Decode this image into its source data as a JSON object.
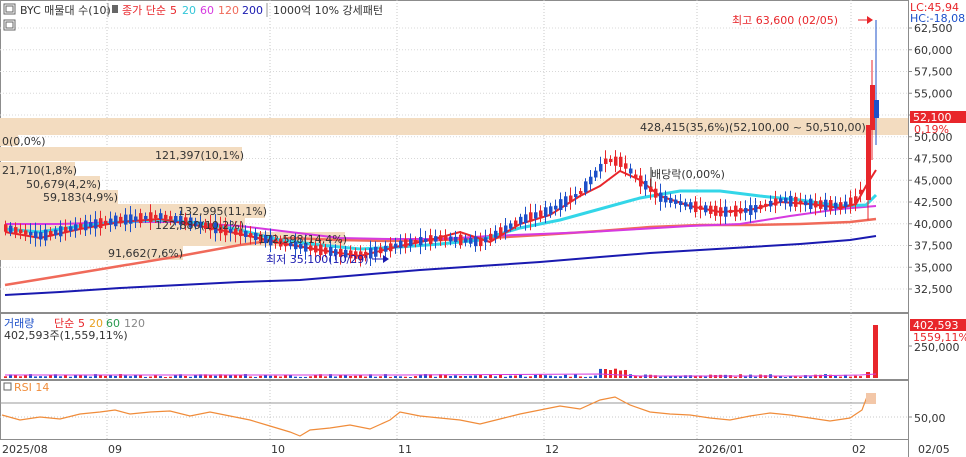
{
  "header": {
    "stock": "BYC 매물대 수(10)",
    "ma_label": "종가 단순",
    "ma_periods": [
      "5",
      "20",
      "60",
      "120",
      "200"
    ],
    "pattern": "1000억 10% 강세패턴"
  },
  "top_right": {
    "lc": "LC:45,94",
    "hc": "HC:-18,08"
  },
  "price_axis": {
    "ticks": [
      "62,500",
      "60,000",
      "57,500",
      "55,000",
      "52,500",
      "50,000",
      "47,500",
      "45,000",
      "42,500",
      "40,000",
      "37,500",
      "35,000",
      "32,500"
    ],
    "current_price": "52,100",
    "current_change": "0,19%"
  },
  "annotations": {
    "high": "최고 63,600 (02/05)",
    "low": "최저 35,100(10/29)",
    "dividend": "배당락(0,00%)"
  },
  "volume_profile": [
    {
      "label": "428,415(35,6%)(52,100,00 ~ 50,510,00)"
    },
    {
      "label": "0(0,0%)"
    },
    {
      "label": "121,397(10,1%)"
    },
    {
      "label": "21,710(1,8%)"
    },
    {
      "label": "50,679(4,2%)"
    },
    {
      "label": "59,183(4,9%)"
    },
    {
      "label": "132,995(11,1%)"
    },
    {
      "label": "122,880(10,2%)"
    },
    {
      "label": "172,598(14,4%)"
    },
    {
      "label": "91,662(7,6%)"
    }
  ],
  "volume_panel": {
    "title": "거래량",
    "ma_label": "단순",
    "ma_periods": [
      "5",
      "20",
      "60",
      "120"
    ],
    "info": "402,593주(1,559,11%)",
    "axis_tick": "250,000",
    "current": "402,593",
    "current_pct": "1559,11%"
  },
  "rsi_panel": {
    "title": "RSI 14",
    "axis_tick": "50,00"
  },
  "date_axis": {
    "labels": [
      "2025/08",
      "09",
      "10",
      "11",
      "12",
      "2026/01",
      "02",
      "02/05"
    ]
  },
  "colors": {
    "up": "#e8262b",
    "down": "#1d50c9",
    "ma5": "#e8262b",
    "ma20": "#33d6e8",
    "ma60": "#d63ae0",
    "ma120": "#f06a5a",
    "ma200": "#1a1ab0",
    "profile": "#f3dcc0",
    "rsi": "#f08c3a"
  },
  "icons": {
    "settings": "grid-icon"
  }
}
